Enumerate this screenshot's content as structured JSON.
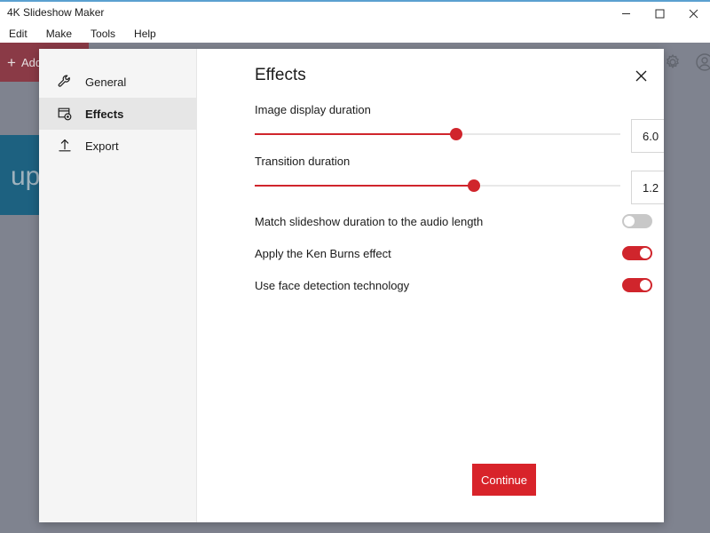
{
  "window": {
    "title": "4K Slideshow Maker",
    "controls": {
      "minimize": "minimize-button",
      "maximize": "maximize-button",
      "close": "close-button"
    }
  },
  "menubar": {
    "items": [
      {
        "label": "Edit"
      },
      {
        "label": "Make"
      },
      {
        "label": "Tools"
      },
      {
        "label": "Help"
      }
    ]
  },
  "background": {
    "add_button_label": "+ Add",
    "add_button_plus": "+",
    "add_button_text": "Add",
    "media_card_text": "up",
    "toolbar_icons": [
      {
        "name": "gear-icon"
      },
      {
        "name": "account-icon"
      }
    ],
    "colors": {
      "scrim": "#7f838f",
      "add_button": "#8a3a46",
      "media_card": "#1d6180"
    }
  },
  "dialog": {
    "title": "Effects",
    "close_label": "×",
    "sidebar": {
      "items": [
        {
          "label": "General",
          "icon": "wrench-icon",
          "selected": false
        },
        {
          "label": "Effects",
          "icon": "effects-frame-icon",
          "selected": true
        },
        {
          "label": "Export",
          "icon": "upload-icon",
          "selected": false
        }
      ]
    },
    "settings": {
      "sliders": [
        {
          "label": "Image display duration",
          "value": "6.0",
          "percent": 55
        },
        {
          "label": "Transition duration",
          "value": "1.2",
          "percent": 60
        }
      ],
      "toggles": [
        {
          "label": "Match slideshow duration to the audio length",
          "on": false
        },
        {
          "label": "Apply the Ken Burns effect",
          "on": true
        },
        {
          "label": "Use face detection technology",
          "on": true
        }
      ]
    },
    "continue_label": "Continue",
    "colors": {
      "accent": "#d0252c",
      "continue_button": "#d8232a",
      "sidebar_bg": "#f5f5f5",
      "selected_bg": "#e6e6e6"
    }
  }
}
